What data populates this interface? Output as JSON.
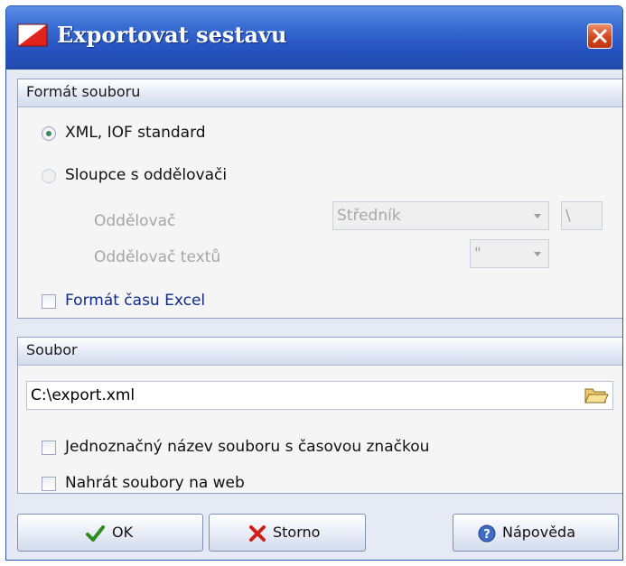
{
  "window": {
    "title": "Exportovat sestavu",
    "accent": "#2854c2"
  },
  "format_group": {
    "header": "Formát souboru",
    "radio_xml": {
      "label": "XML, IOF standard",
      "checked": true
    },
    "radio_columns": {
      "label": "Sloupce s oddělovači",
      "checked": false
    },
    "separator": {
      "label": "Oddělovač",
      "value": "Středník",
      "extra_value": "\\"
    },
    "text_separator": {
      "label": "Oddělovač textů",
      "value": "\""
    },
    "excel_time": {
      "label": "Formát času Excel",
      "checked": false
    }
  },
  "file_group": {
    "header": "Soubor",
    "path": {
      "value": "C:\\export.xml"
    },
    "unique_name": {
      "label": "Jednoznačný název souboru s časovou značkou",
      "checked": false
    },
    "upload_web": {
      "label": "Nahrát soubory na web",
      "checked": false
    }
  },
  "buttons": {
    "ok": "OK",
    "cancel": "Storno",
    "help": "Nápověda"
  },
  "icons": {
    "app": "app-logo-icon",
    "close": "close-icon",
    "folder": "folder-icon",
    "ok": "checkmark-icon",
    "cancel": "x-icon",
    "help": "help-icon"
  }
}
